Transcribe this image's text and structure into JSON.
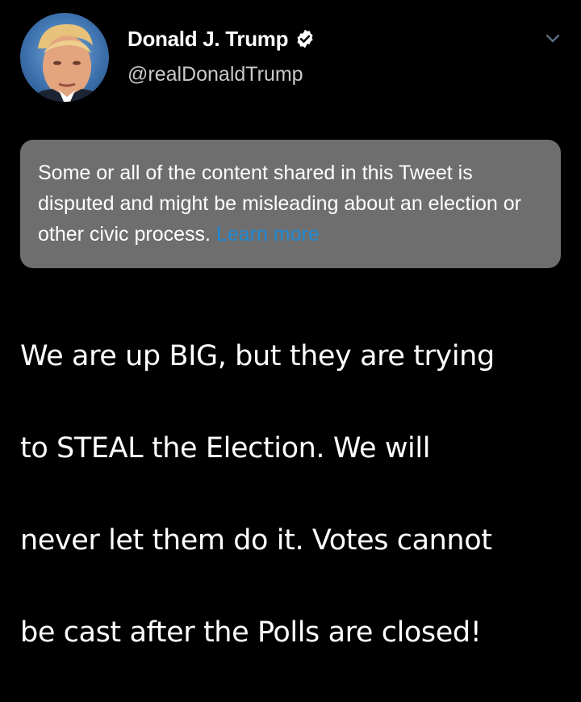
{
  "author": {
    "display_name": "Donald J. Trump",
    "handle": "@realDonaldTrump",
    "verified": true,
    "verified_icon": "verified-badge-icon",
    "avatar_icon": "avatar"
  },
  "menu": {
    "icon": "chevron-down-icon"
  },
  "notice": {
    "text": "Some or all of the content shared in this Tweet is disputed and might be misleading about an election or other civic process.",
    "link_label": "Learn more"
  },
  "tweet": {
    "lines": [
      "We are up BIG, but they are trying",
      "to STEAL the Election. We will",
      "never let them do it. Votes cannot",
      "be cast after the Polls are closed!"
    ]
  },
  "colors": {
    "background": "#000000",
    "notice_background": "#6e6e6e",
    "link": "#1f8ad6",
    "handle": "#c9c9c9",
    "verified": "#ffffff"
  }
}
